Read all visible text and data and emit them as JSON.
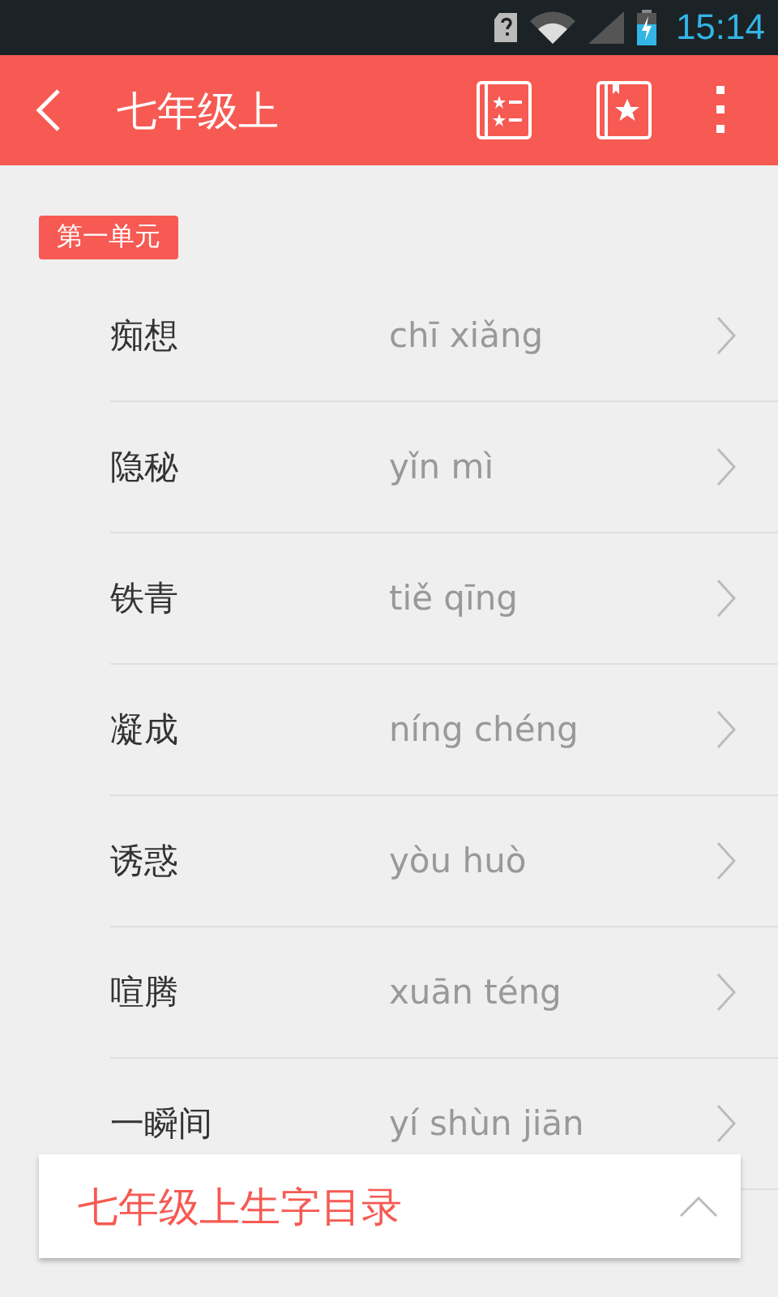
{
  "status_bar": {
    "time": "15:14"
  },
  "app_bar": {
    "title": "七年级上"
  },
  "unit": {
    "label": "第一单元"
  },
  "words": [
    {
      "hanzi": "痴想",
      "pinyin": "chī xiǎng"
    },
    {
      "hanzi": "隐秘",
      "pinyin": "yǐn mì"
    },
    {
      "hanzi": "铁青",
      "pinyin": "tiě qīng"
    },
    {
      "hanzi": "凝成",
      "pinyin": "níng chéng"
    },
    {
      "hanzi": "诱惑",
      "pinyin": "yòu huò"
    },
    {
      "hanzi": "喧腾",
      "pinyin": "xuān téng"
    },
    {
      "hanzi": "一瞬间",
      "pinyin": "yí shùn jiān"
    }
  ],
  "catalog_panel": {
    "title": "七年级上生字目录",
    "expanded": false
  }
}
